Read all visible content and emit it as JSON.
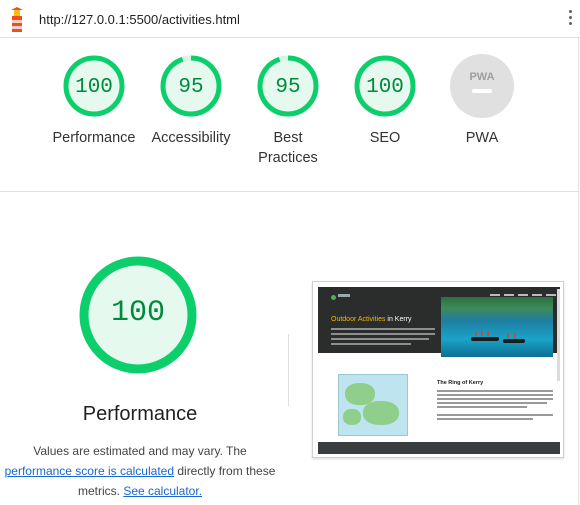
{
  "address_bar": {
    "url": "http://127.0.0.1:5500/activities.html",
    "logo_icon": "lighthouse-icon",
    "menu_icon": "kebab-menu-icon"
  },
  "summary": {
    "gauges": [
      {
        "label": "Performance",
        "score": "100",
        "status": "pass"
      },
      {
        "label": "Accessibility",
        "score": "95",
        "status": "pass"
      },
      {
        "label": "Best Practices",
        "score": "95",
        "status": "pass"
      },
      {
        "label": "SEO",
        "score": "100",
        "status": "pass"
      },
      {
        "label": "PWA",
        "score": "",
        "status": "na"
      }
    ],
    "pwa_badge_text": "PWA"
  },
  "performance": {
    "score": "100",
    "title": "Performance",
    "desc_prefix": "Values are estimated and may vary. The ",
    "link_score_calculated": "performance score is calculated",
    "desc_middle": " directly from these metrics. ",
    "link_calculator": "See calculator.",
    "score_fraction": 1.0
  },
  "thumbnail": {
    "hero_title_highlight": "Outdoor Activities",
    "hero_title_rest": " in Kerry",
    "section_title": "The Ring of Kerry"
  },
  "colors": {
    "pass_stroke": "#0cce6b",
    "pass_fill": "#e6f9ee",
    "pass_text": "#008a3e",
    "na_fill": "#e0e0e0",
    "na_text": "#9e9e9e",
    "link": "#1967d2",
    "highlight": "#f5b800"
  }
}
